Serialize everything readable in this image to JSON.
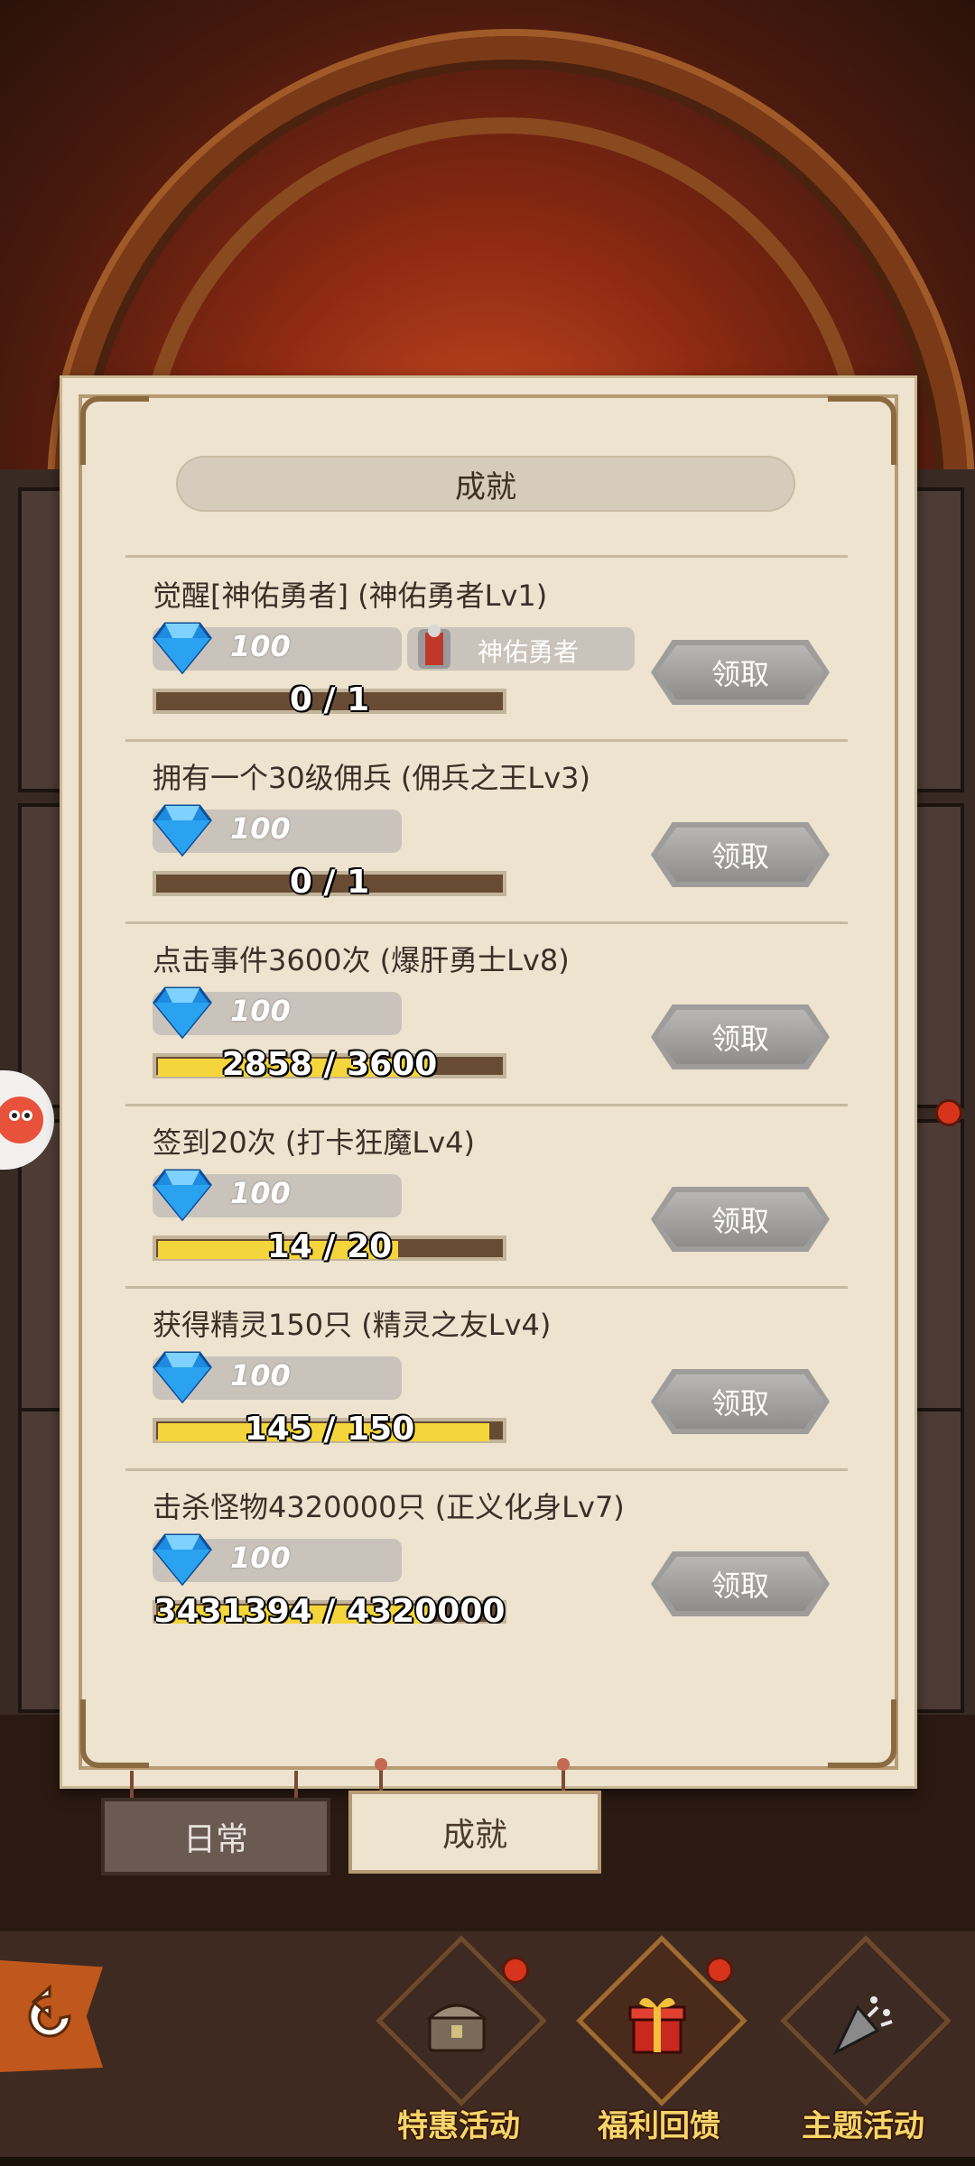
{
  "header": {
    "title": "成就"
  },
  "achievements": [
    {
      "title": "觉醒[神佑勇者]  (神佑勇者Lv1)",
      "reward_icon": "diamond-gem-icon",
      "reward_amount": "100",
      "item_label": "神佑勇者",
      "item_icon": "armor-icon",
      "progress_text": "0 / 1",
      "progress": 0.0,
      "claim_label": "领取"
    },
    {
      "title": "拥有一个30级佣兵  (佣兵之王Lv3)",
      "reward_icon": "diamond-gem-icon",
      "reward_amount": "100",
      "progress_text": "0 / 1",
      "progress": 0.0,
      "claim_label": "领取"
    },
    {
      "title": "点击事件3600次  (爆肝勇士Lv8)",
      "reward_icon": "diamond-gem-icon",
      "reward_amount": "100",
      "progress_text": "2858 / 3600",
      "progress": 0.794,
      "claim_label": "领取"
    },
    {
      "title": "签到20次  (打卡狂魔Lv4)",
      "reward_icon": "diamond-gem-icon",
      "reward_amount": "100",
      "progress_text": "14 / 20",
      "progress": 0.7,
      "claim_label": "领取"
    },
    {
      "title": "获得精灵150只  (精灵之友Lv4)",
      "reward_icon": "diamond-gem-icon",
      "reward_amount": "100",
      "progress_text": "145 / 150",
      "progress": 0.967,
      "claim_label": "领取"
    },
    {
      "title": "击杀怪物4320000只  (正义化身Lv7)",
      "reward_icon": "diamond-gem-icon",
      "reward_amount": "100",
      "progress_text": "3431394 / 4320000",
      "progress": 0.794,
      "claim_label": "领取"
    }
  ],
  "tabs": [
    {
      "label": "日常",
      "selected": false
    },
    {
      "label": "成就",
      "selected": true
    }
  ],
  "bottom_nav": [
    {
      "label": "特惠活动",
      "icon": "treasure-chest-icon",
      "badge": true
    },
    {
      "label": "福利回馈",
      "icon": "gift-box-icon",
      "badge": true
    },
    {
      "label": "主题活动",
      "icon": "party-popper-icon",
      "badge": false
    }
  ],
  "colors": {
    "progress_fill": "#f4d63c",
    "progress_track": "#684b33",
    "panel": "#ede3cf",
    "nav_label": "#f6d56a"
  }
}
